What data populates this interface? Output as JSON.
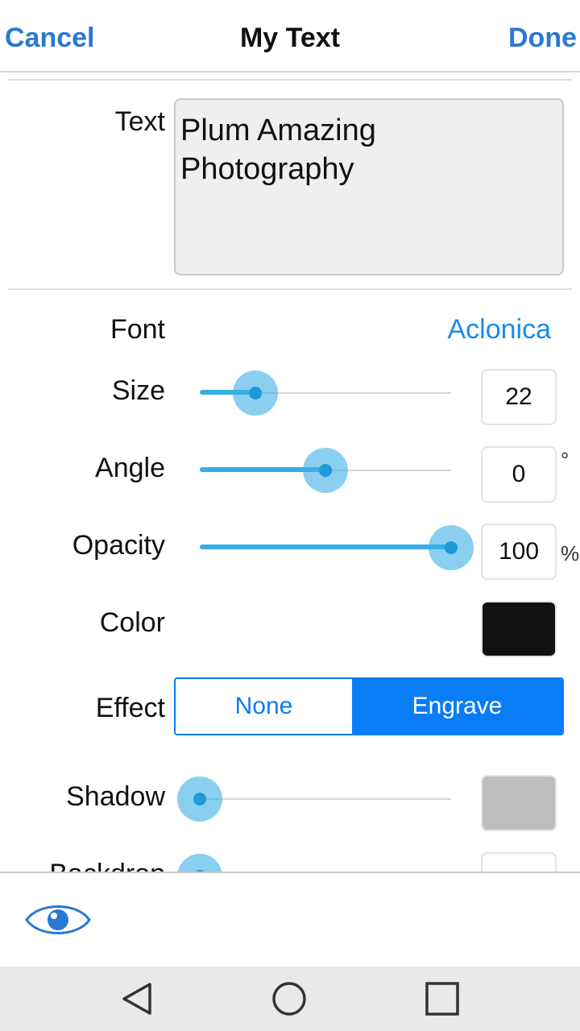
{
  "header": {
    "cancel_label": "Cancel",
    "title": "My Text",
    "done_label": "Done"
  },
  "text_field": {
    "label": "Text",
    "value": "Plum Amazing Photography"
  },
  "font": {
    "label": "Font",
    "value": "Aclonica"
  },
  "size": {
    "label": "Size",
    "value": "22",
    "slider_fraction": 0.22
  },
  "angle": {
    "label": "Angle",
    "value": "0",
    "unit": "°",
    "slider_fraction": 0.5
  },
  "opacity": {
    "label": "Opacity",
    "value": "100",
    "unit": "%",
    "slider_fraction": 1.0
  },
  "color": {
    "label": "Color",
    "swatch": "#111111"
  },
  "effect": {
    "label": "Effect",
    "options": [
      "None",
      "Engrave"
    ],
    "selected": "Engrave"
  },
  "shadow": {
    "label": "Shadow",
    "slider_fraction": 0.0,
    "swatch": "#bdbdbd"
  },
  "backdrop": {
    "label": "Backdrop",
    "slider_fraction": 0.0
  },
  "bottom": {
    "preview_icon": "eye-icon"
  },
  "navbar": {
    "icons": [
      "back-icon",
      "home-icon",
      "recents-icon"
    ]
  },
  "colors": {
    "accent": "#2a78d4",
    "link": "#1a8ae8",
    "segment": "#0a7cf5",
    "slider": "#35aee3"
  }
}
